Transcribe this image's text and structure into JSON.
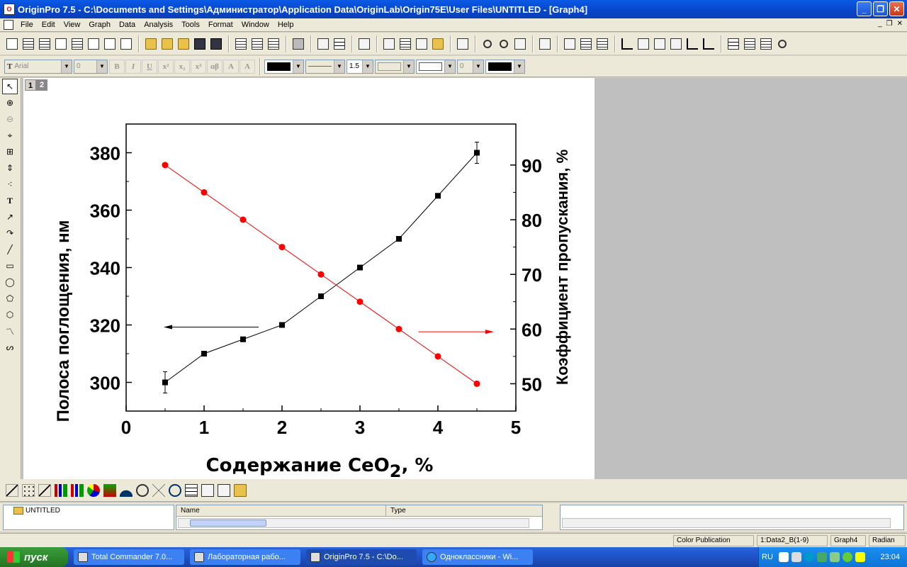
{
  "window": {
    "title": "OriginPro 7.5 - C:\\Documents and Settings\\Администратор\\Application Data\\OriginLab\\Origin75E\\User Files\\UNTITLED - [Graph4]"
  },
  "menu": [
    "File",
    "Edit",
    "View",
    "Graph",
    "Data",
    "Analysis",
    "Tools",
    "Format",
    "Window",
    "Help"
  ],
  "format_toolbar": {
    "font": "Arial",
    "font_size": "0",
    "line_width": "1.5",
    "pattern_value": "0"
  },
  "layer_tabs": [
    "1",
    "2"
  ],
  "graph": {
    "xlabel_main": "Содержание CeO",
    "xlabel_sub": "2",
    "xlabel_tail": ", %",
    "ylabel_left": "Полоса поглощения, нм",
    "ylabel_right": "Коэффициент пропускания, %"
  },
  "chart_data": {
    "type": "line",
    "x_ticks": [
      "0",
      "1",
      "2",
      "3",
      "4",
      "5"
    ],
    "y_left_ticks": [
      "300",
      "320",
      "340",
      "360",
      "380"
    ],
    "y_right_ticks": [
      "50",
      "60",
      "70",
      "80",
      "90"
    ],
    "xlim": [
      0,
      5
    ],
    "ylim_left": [
      290,
      390
    ],
    "ylim_right": [
      45,
      97.5
    ],
    "series": [
      {
        "axis": "left",
        "color": "#000000",
        "marker": "square",
        "x": [
          0.5,
          1.0,
          1.5,
          2.0,
          2.5,
          3.0,
          3.5,
          4.0,
          4.5
        ],
        "values": [
          300,
          310,
          315,
          320,
          330,
          340,
          350,
          365,
          380
        ],
        "error_bars_on": [
          0,
          8
        ]
      },
      {
        "axis": "right",
        "color": "#ff0000",
        "marker": "circle",
        "x": [
          0.5,
          1.0,
          1.5,
          2.0,
          2.5,
          3.0,
          3.5,
          4.0,
          4.5
        ],
        "values": [
          90,
          85,
          80,
          75,
          70,
          65,
          60,
          55,
          50
        ]
      }
    ]
  },
  "project_explorer": {
    "root": "UNTITLED",
    "columns": [
      "Name",
      "Type"
    ]
  },
  "status": {
    "mode": "Color Publication",
    "dataset": "1:Data2_B(1-9)",
    "window": "Graph4",
    "angle": "Radian"
  },
  "taskbar": {
    "start": "пуск",
    "tasks": [
      "Total Commander 7.0...",
      "Лабораторная рабо...",
      "OriginPro 7.5 - C:\\Do...",
      "Одноклассники - Wi..."
    ],
    "lang": "RU",
    "clock": "23:04"
  }
}
